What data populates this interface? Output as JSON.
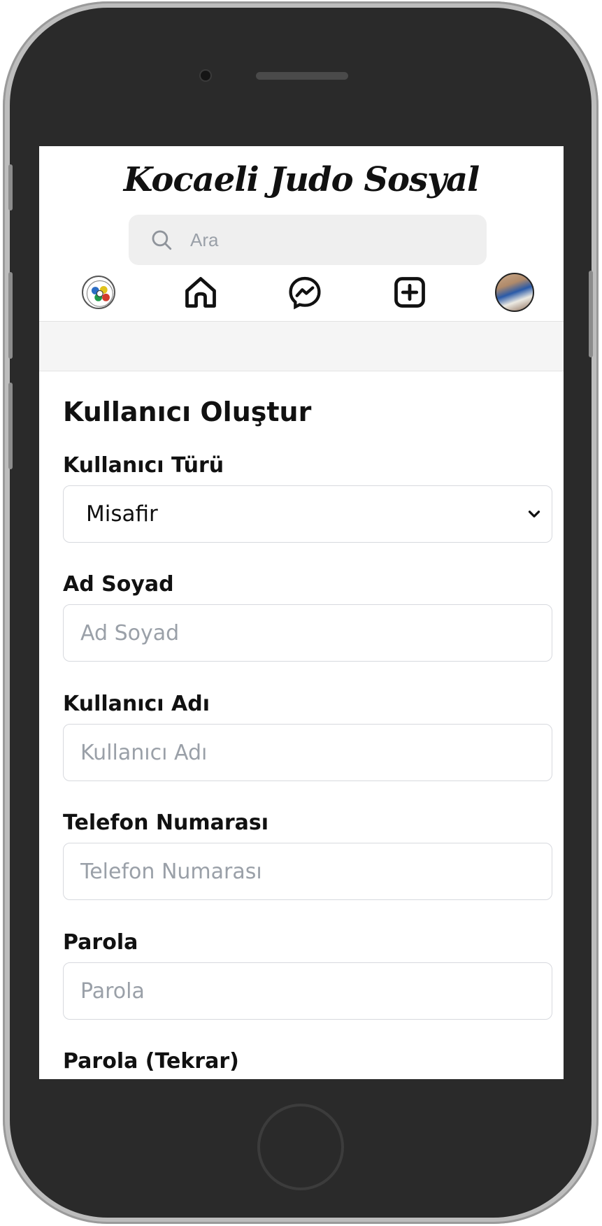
{
  "header": {
    "brand_title": "Kocaeli Judo Sosyal",
    "search_placeholder": "Ara"
  },
  "nav": {
    "items": [
      {
        "name": "federation-logo-icon"
      },
      {
        "name": "home-icon"
      },
      {
        "name": "messenger-icon"
      },
      {
        "name": "add-post-icon"
      },
      {
        "name": "profile-avatar"
      }
    ]
  },
  "form": {
    "title": "Kullanıcı Oluştur",
    "user_type": {
      "label": "Kullanıcı Türü",
      "value": "Misafir"
    },
    "full_name": {
      "label": "Ad Soyad",
      "placeholder": "Ad Soyad"
    },
    "username": {
      "label": "Kullanıcı Adı",
      "placeholder": "Kullanıcı Adı"
    },
    "phone": {
      "label": "Telefon Numarası",
      "placeholder": "Telefon Numarası"
    },
    "password": {
      "label": "Parola",
      "placeholder": "Parola"
    },
    "password_repeat": {
      "label": "Parola (Tekrar)"
    }
  },
  "colors": {
    "device_frame": "#2a2a2a",
    "device_rim": "#bdbdbd",
    "search_bg": "#efefef",
    "band_bg": "#f5f5f5",
    "placeholder": "#9aa0a8",
    "field_border": "#d7d9de"
  }
}
